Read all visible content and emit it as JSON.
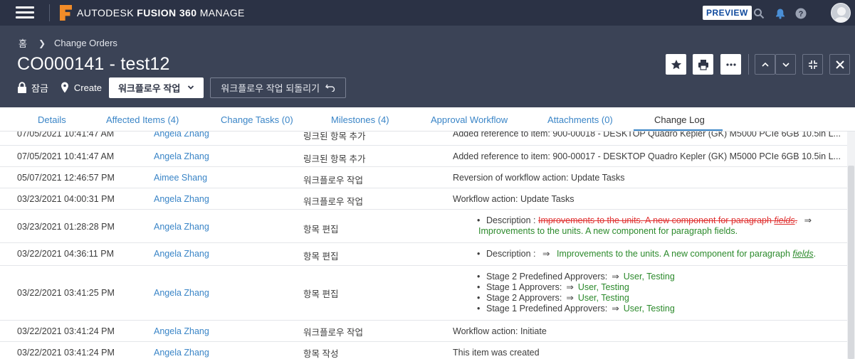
{
  "app": {
    "brand": "AUTODESK",
    "product": "FUSION 360",
    "module": "MANAGE",
    "preview_badge": "PREVIEW"
  },
  "breadcrumb": {
    "home": "홈",
    "section": "Change Orders"
  },
  "item": {
    "title": "CO000141 - test12",
    "lock_label": "잠금",
    "state_label": "Create",
    "workflow_action_label": "워크플로우 작업",
    "undo_workflow_label": "워크플로우 작업 되돌리기"
  },
  "tabs": [
    {
      "label": "Details"
    },
    {
      "label": "Affected Items (4)"
    },
    {
      "label": "Change Tasks (0)"
    },
    {
      "label": "Milestones (4)"
    },
    {
      "label": "Approval Workflow"
    },
    {
      "label": "Attachments (0)"
    },
    {
      "label": "Change Log"
    }
  ],
  "log": [
    {
      "date": "07/05/2021 10:41:47 AM",
      "user": "Angela Zhang",
      "action": "링크된 항목 추가",
      "description": "Added reference to item: 900-00018 - DESKTOP Quadro Kepler (GK) M5000 PCIe 6GB 10.5in L..."
    },
    {
      "date": "07/05/2021 10:41:47 AM",
      "user": "Angela Zhang",
      "action": "링크된 항목 추가",
      "description": "Added reference to item: 900-00017 - DESKTOP Quadro Kepler (GK) M5000 PCIe 6GB 10.5in L..."
    },
    {
      "date": "05/07/2021 12:46:57 PM",
      "user": "Aimee Shang",
      "action": "워크플로우 작업",
      "description": "Reversion of workflow action: Update Tasks"
    },
    {
      "date": "03/23/2021 04:00:31 PM",
      "user": "Angela Zhang",
      "action": "워크플로우 작업",
      "description": "Workflow action: Update Tasks"
    },
    {
      "date": "03/23/2021 01:28:28 PM",
      "user": "Angela Zhang",
      "action": "항목 편집",
      "edit": {
        "field": "Description :",
        "old_text": "Improvements to the units. A new component for paragraph ",
        "old_italic": "fields",
        "old_end": ".",
        "arrow": "⇒",
        "new_text": "Improvements to the units. A new component for paragraph fields."
      }
    },
    {
      "date": "03/22/2021 04:36:11 PM",
      "user": "Angela Zhang",
      "action": "항목 편집",
      "edit": {
        "field": "Description :",
        "arrow": "⇒",
        "new_text": "Improvements to the units. A new component for paragraph ",
        "new_italic": "fields",
        "new_end": "."
      }
    },
    {
      "date": "03/22/2021 03:41:25 PM",
      "user": "Angela Zhang",
      "action": "항목 편집",
      "changes": [
        {
          "field": "Stage 2 Predefined Approvers:",
          "arrow": "⇒",
          "value": "User, Testing"
        },
        {
          "field": "Stage 1 Approvers:",
          "arrow": "⇒",
          "value": "User, Testing"
        },
        {
          "field": "Stage 2 Approvers:",
          "arrow": "⇒",
          "value": "User, Testing"
        },
        {
          "field": "Stage 1 Predefined Approvers:",
          "arrow": "⇒",
          "value": "User, Testing"
        }
      ]
    },
    {
      "date": "03/22/2021 03:41:24 PM",
      "user": "Angela Zhang",
      "action": "워크플로우 작업",
      "description": "Workflow action: Initiate"
    },
    {
      "date": "03/22/2021 03:41:24 PM",
      "user": "Angela Zhang",
      "action": "항목 작성",
      "description": "This item was created"
    }
  ],
  "colors": {
    "topbar": "#2b3245",
    "header": "#3b4356",
    "link": "#3a85c7",
    "old_value": "#e03131",
    "new_value": "#2c8a2c"
  }
}
